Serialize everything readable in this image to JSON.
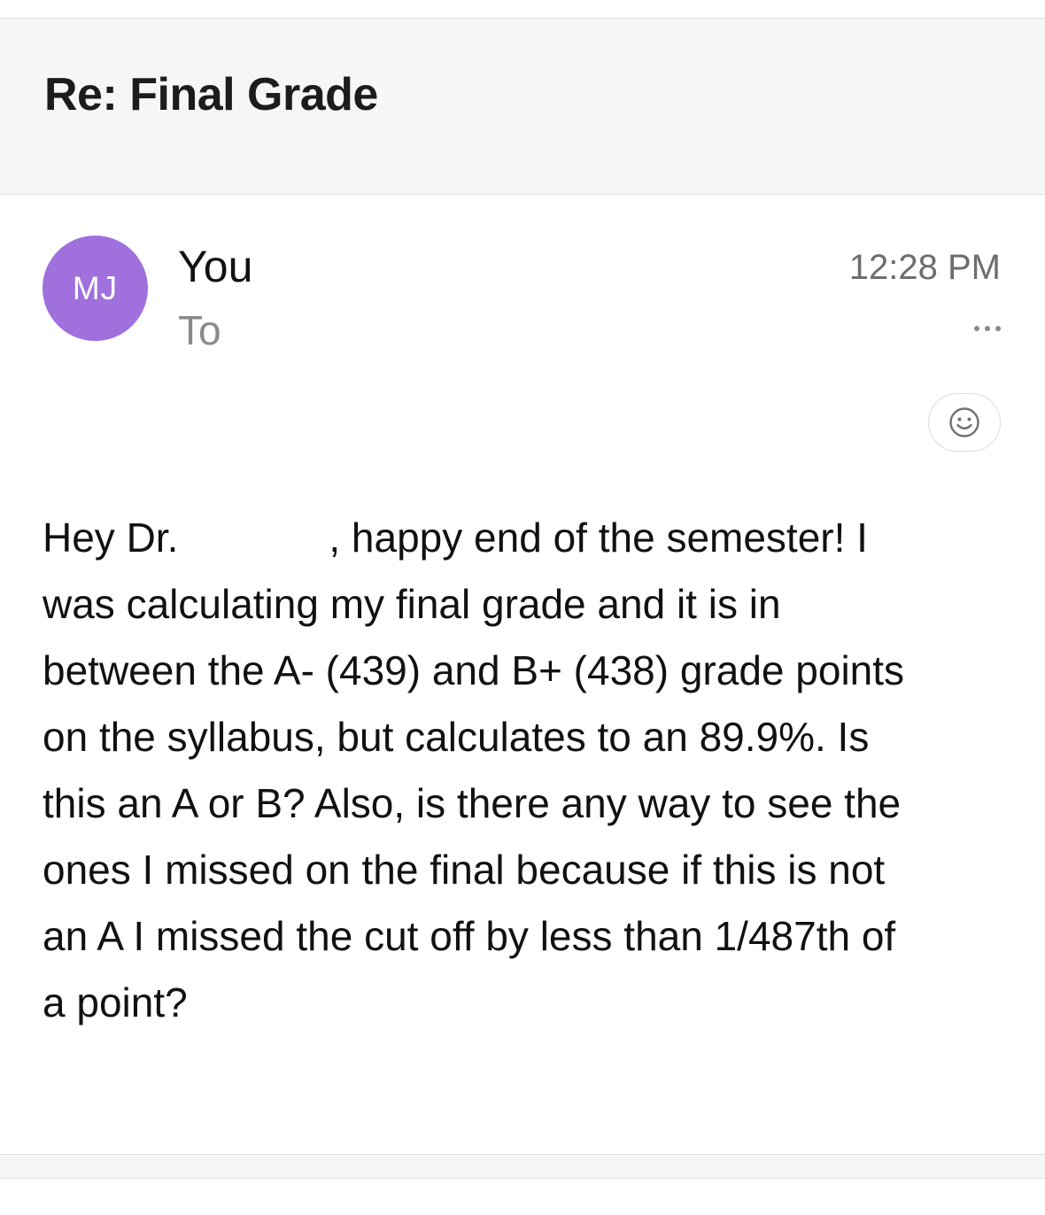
{
  "subject": "Re: Final Grade",
  "message": {
    "avatar_initials": "MJ",
    "avatar_color": "#a070dd",
    "sender": "You",
    "to_label": "To",
    "time": "12:28 PM",
    "more_icon": "ellipsis-icon",
    "reaction_icon": "smiley-icon",
    "body_lines": [
      "Hey Dr.",
      ", happy end of the semester! I",
      "was calculating my final grade and it is in",
      "between the A- (439) and B+ (438) grade points",
      "on the syllabus, but calculates to an 89.9%. Is",
      "this an A or B? Also, is there any way to see the",
      "ones I missed on the final because if this is not",
      "an A I missed the cut off by less than 1/487th of",
      "a point?"
    ]
  }
}
